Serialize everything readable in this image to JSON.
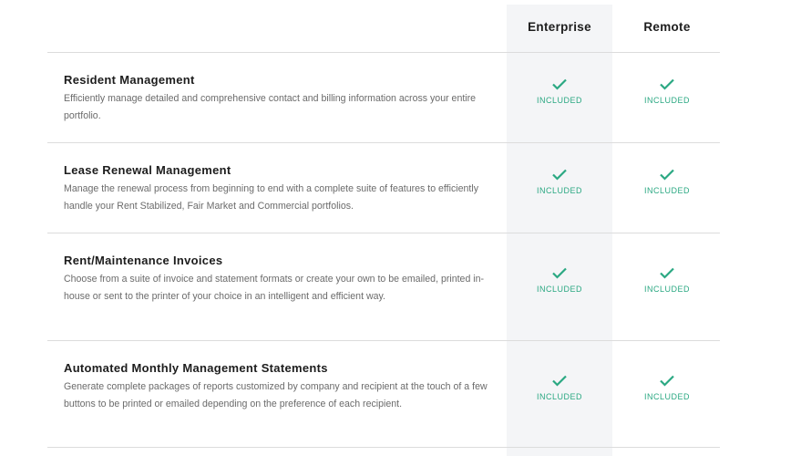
{
  "columns": [
    "Enterprise",
    "Remote"
  ],
  "included_label": "INCLUDED",
  "accent": "#2aa882",
  "features": [
    {
      "title": "Resident Management",
      "desc": "Efficiently manage detailed and comprehensive contact and billing information across your entire portfolio."
    },
    {
      "title": "Lease Renewal Management",
      "desc": "Manage the renewal process from beginning to end with a complete suite of features to efficiently handle your Rent Stabilized, Fair Market and Commercial portfolios."
    },
    {
      "title": "Rent/Maintenance Invoices",
      "desc": "Choose from a suite of invoice and statement formats or create your own to be emailed, printed in-house or sent to the printer of your choice in an intelligent and efficient way."
    },
    {
      "title": "Automated Monthly Management Statements",
      "desc": "Generate complete packages of reports customized by company and recipient at the touch of a few buttons to be printed or emailed depending on the preference of each recipient."
    }
  ]
}
